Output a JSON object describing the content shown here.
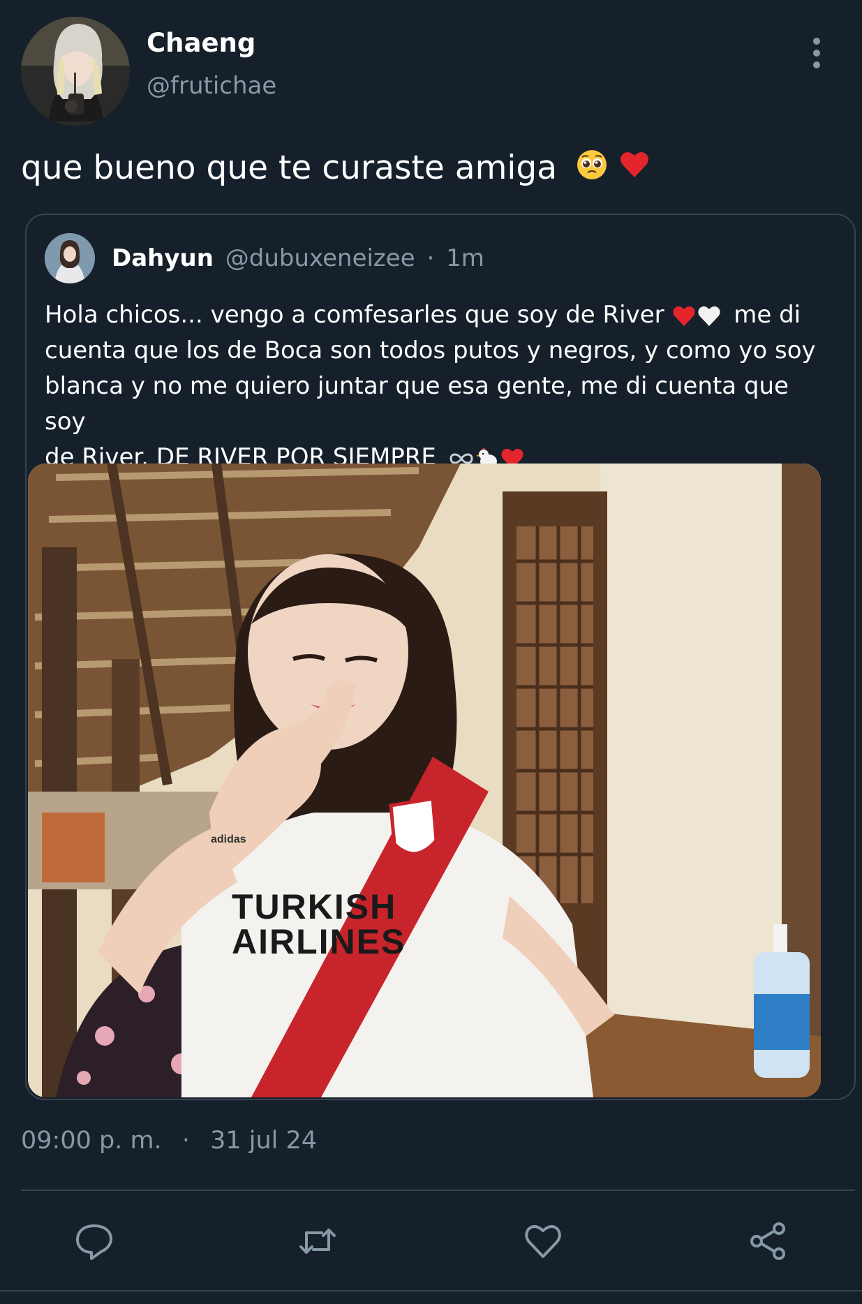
{
  "author": {
    "display_name": "Chaeng",
    "handle": "@frutichae"
  },
  "tweet": {
    "text": "que bueno que te curaste amiga",
    "emojis": [
      "pleading-face-icon",
      "red-heart-icon"
    ]
  },
  "quoted": {
    "display_name": "Dahyun",
    "handle": "@dubuxeneizee",
    "separator": "·",
    "time": "1m",
    "text_lines": [
      "Hola chicos... vengo a comfesarles que soy de River",
      "me di",
      "cuenta que los de Boca son todos putos y negros, y como yo soy",
      "blanca y no me quiero juntar que esa gente, me di cuenta que soy",
      "de River. DE RIVER POR SIEMPRE"
    ],
    "media": {
      "description_icons": [
        "photo"
      ],
      "shirt_text_line1": "TURKISH",
      "shirt_text_line2": "AIRLINES",
      "shirt_brand": "adidas"
    }
  },
  "meta": {
    "time": "09:00 p. m.",
    "separator": "·",
    "date": "31 jul 24"
  },
  "actions": {
    "reply_icon": "reply-icon",
    "retweet_icon": "retweet-icon",
    "like_icon": "heart-icon",
    "share_icon": "share-icon"
  },
  "colors": {
    "background": "#15202b",
    "secondary_text": "#8899a6",
    "border": "#38444d",
    "heart_red": "#e0245e"
  }
}
